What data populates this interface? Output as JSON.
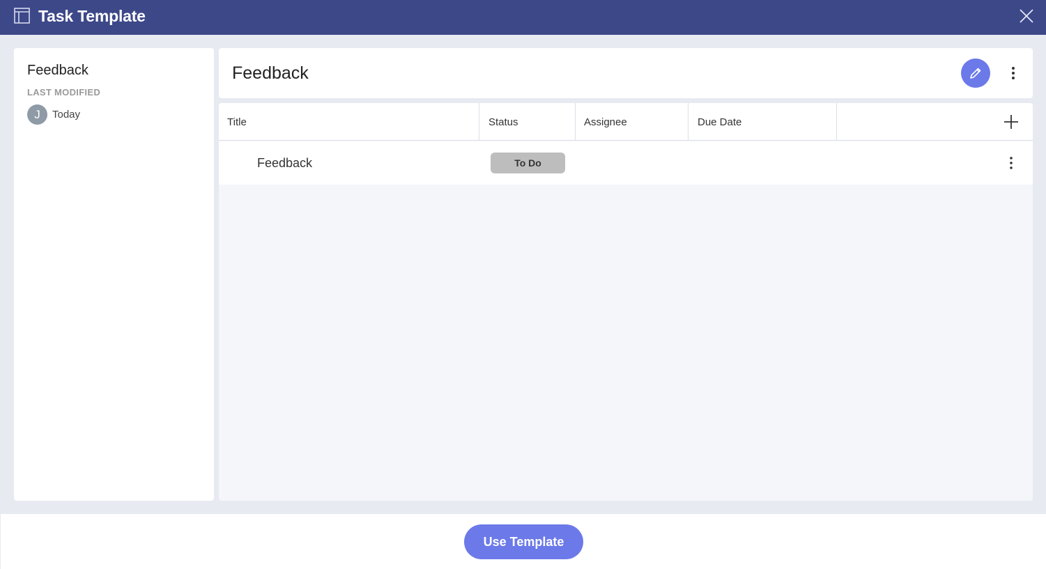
{
  "window": {
    "title": "Task Template",
    "icon": "template-icon",
    "close_icon": "close-icon"
  },
  "sidebar": {
    "title": "Feedback",
    "last_modified_label": "LAST MODIFIED",
    "avatar_initial": "J",
    "modified_date": "Today"
  },
  "header": {
    "title": "Feedback",
    "edit_icon": "pencil-icon",
    "more_icon": "more-vertical-icon"
  },
  "table": {
    "columns": [
      "Title",
      "Status",
      "Assignee",
      "Due Date"
    ],
    "add_column_icon": "plus-icon",
    "rows": [
      {
        "title": "Feedback",
        "status": "To Do",
        "assignee": "",
        "due_date": ""
      }
    ]
  },
  "footer": {
    "use_template_label": "Use Template"
  },
  "colors": {
    "titlebar": "#3d4889",
    "accent": "#6b79e9",
    "status_todo": "#bdbdbd"
  }
}
